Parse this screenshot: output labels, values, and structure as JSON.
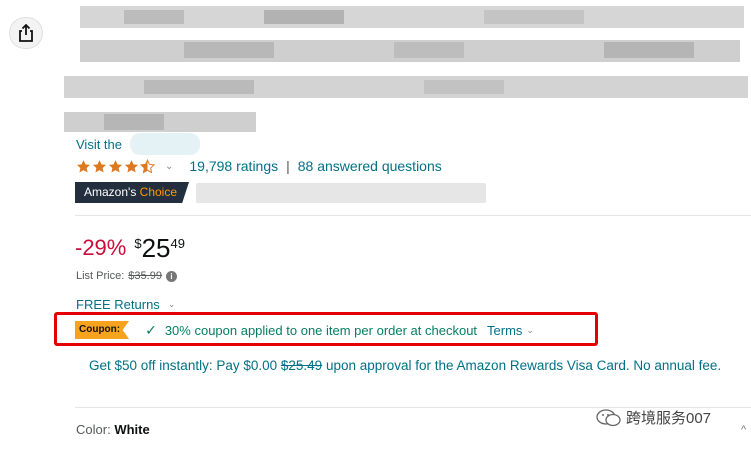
{
  "product": {
    "visit_text": "Visit the",
    "ratings_count": "19,798 ratings",
    "separator": "|",
    "answered": "88 answered questions",
    "choice_prefix": "Amazon's",
    "choice_suffix": "Choice",
    "rating_stars": 4.5
  },
  "price": {
    "discount": "-29%",
    "currency": "$",
    "whole": "25",
    "fraction": "49",
    "list_label": "List Price:",
    "list_value": "$35.99",
    "info_glyph": "i"
  },
  "returns": {
    "label": "FREE Returns"
  },
  "coupon": {
    "badge": "Coupon:",
    "check": "✓",
    "text": "30% coupon applied to one item per order at checkout",
    "terms": "Terms"
  },
  "visa": {
    "prefix": "Get $50 off instantly: Pay $0.00",
    "strike": "$25.49",
    "suffix": "upon approval for the Amazon Rewards Visa Card. No annual fee."
  },
  "color": {
    "label": "Color:",
    "value": "White"
  },
  "watermark": {
    "text": "跨境服务007"
  },
  "colors": {
    "link": "#007185",
    "discount": "#cc0c39",
    "coupon_green": "#067d62",
    "highlight_red": "#e40000",
    "badge_orange": "#f7a31e"
  }
}
